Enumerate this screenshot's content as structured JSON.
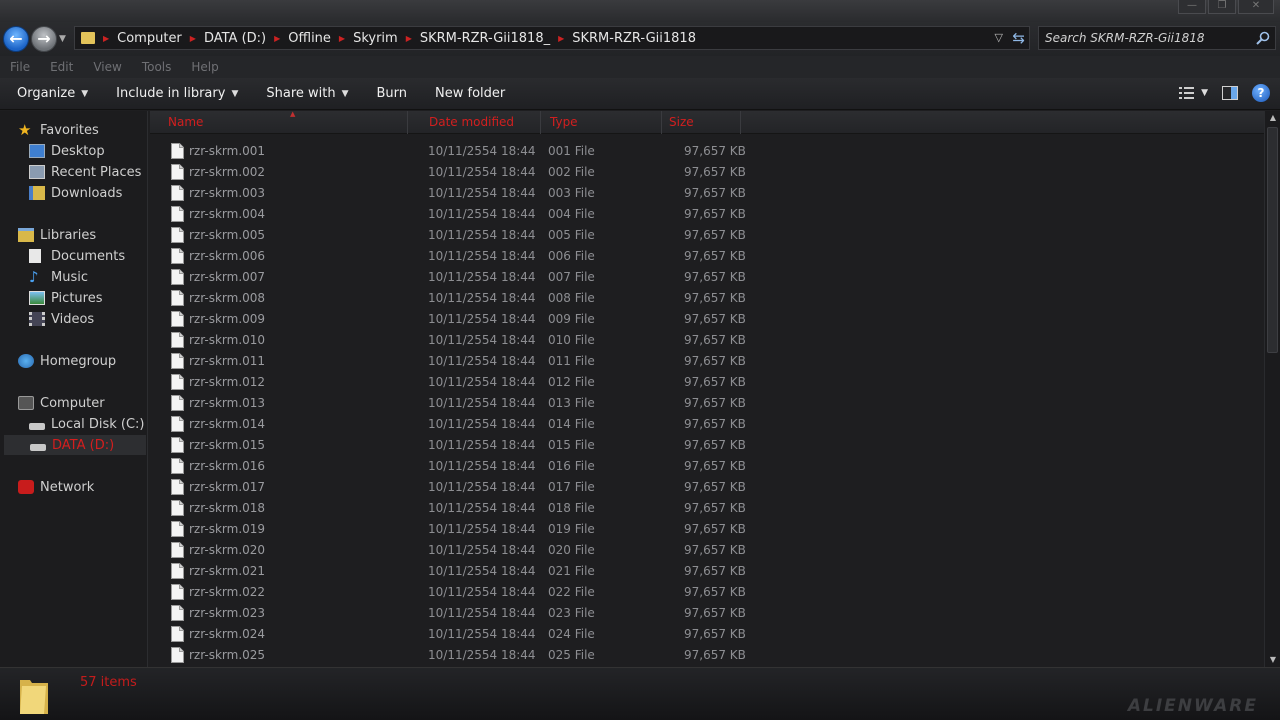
{
  "titlebar": {
    "minimize": "—",
    "maximize": "❐",
    "close": "✕"
  },
  "address": {
    "crumbs": [
      "Computer",
      "DATA (D:)",
      "Offline",
      "Skyrim",
      "SKRM-RZR-Gii1818_",
      "SKRM-RZR-Gii1818"
    ]
  },
  "search": {
    "placeholder": "Search SKRM-RZR-Gii1818"
  },
  "menu": {
    "file": "File",
    "edit": "Edit",
    "view": "View",
    "tools": "Tools",
    "help": "Help"
  },
  "toolbar": {
    "organize": "Organize",
    "include_in_library": "Include in library",
    "share_with": "Share with",
    "burn": "Burn",
    "new_folder": "New folder",
    "help_glyph": "?"
  },
  "nav": {
    "favorites": "Favorites",
    "desktop": "Desktop",
    "recent_places": "Recent Places",
    "downloads": "Downloads",
    "libraries": "Libraries",
    "documents": "Documents",
    "music": "Music",
    "pictures": "Pictures",
    "videos": "Videos",
    "homegroup": "Homegroup",
    "computer": "Computer",
    "local_disk": "Local Disk (C:)",
    "data_drive": "DATA (D:)",
    "network": "Network"
  },
  "columns": {
    "name": "Name",
    "date": "Date modified",
    "type": "Type",
    "size": "Size"
  },
  "files": [
    {
      "name": "rzr-skrm.001",
      "date": "10/11/2554 18:44",
      "type": "001 File",
      "size": "97,657 KB"
    },
    {
      "name": "rzr-skrm.002",
      "date": "10/11/2554 18:44",
      "type": "002 File",
      "size": "97,657 KB"
    },
    {
      "name": "rzr-skrm.003",
      "date": "10/11/2554 18:44",
      "type": "003 File",
      "size": "97,657 KB"
    },
    {
      "name": "rzr-skrm.004",
      "date": "10/11/2554 18:44",
      "type": "004 File",
      "size": "97,657 KB"
    },
    {
      "name": "rzr-skrm.005",
      "date": "10/11/2554 18:44",
      "type": "005 File",
      "size": "97,657 KB"
    },
    {
      "name": "rzr-skrm.006",
      "date": "10/11/2554 18:44",
      "type": "006 File",
      "size": "97,657 KB"
    },
    {
      "name": "rzr-skrm.007",
      "date": "10/11/2554 18:44",
      "type": "007 File",
      "size": "97,657 KB"
    },
    {
      "name": "rzr-skrm.008",
      "date": "10/11/2554 18:44",
      "type": "008 File",
      "size": "97,657 KB"
    },
    {
      "name": "rzr-skrm.009",
      "date": "10/11/2554 18:44",
      "type": "009 File",
      "size": "97,657 KB"
    },
    {
      "name": "rzr-skrm.010",
      "date": "10/11/2554 18:44",
      "type": "010 File",
      "size": "97,657 KB"
    },
    {
      "name": "rzr-skrm.011",
      "date": "10/11/2554 18:44",
      "type": "011 File",
      "size": "97,657 KB"
    },
    {
      "name": "rzr-skrm.012",
      "date": "10/11/2554 18:44",
      "type": "012 File",
      "size": "97,657 KB"
    },
    {
      "name": "rzr-skrm.013",
      "date": "10/11/2554 18:44",
      "type": "013 File",
      "size": "97,657 KB"
    },
    {
      "name": "rzr-skrm.014",
      "date": "10/11/2554 18:44",
      "type": "014 File",
      "size": "97,657 KB"
    },
    {
      "name": "rzr-skrm.015",
      "date": "10/11/2554 18:44",
      "type": "015 File",
      "size": "97,657 KB"
    },
    {
      "name": "rzr-skrm.016",
      "date": "10/11/2554 18:44",
      "type": "016 File",
      "size": "97,657 KB"
    },
    {
      "name": "rzr-skrm.017",
      "date": "10/11/2554 18:44",
      "type": "017 File",
      "size": "97,657 KB"
    },
    {
      "name": "rzr-skrm.018",
      "date": "10/11/2554 18:44",
      "type": "018 File",
      "size": "97,657 KB"
    },
    {
      "name": "rzr-skrm.019",
      "date": "10/11/2554 18:44",
      "type": "019 File",
      "size": "97,657 KB"
    },
    {
      "name": "rzr-skrm.020",
      "date": "10/11/2554 18:44",
      "type": "020 File",
      "size": "97,657 KB"
    },
    {
      "name": "rzr-skrm.021",
      "date": "10/11/2554 18:44",
      "type": "021 File",
      "size": "97,657 KB"
    },
    {
      "name": "rzr-skrm.022",
      "date": "10/11/2554 18:44",
      "type": "022 File",
      "size": "97,657 KB"
    },
    {
      "name": "rzr-skrm.023",
      "date": "10/11/2554 18:44",
      "type": "023 File",
      "size": "97,657 KB"
    },
    {
      "name": "rzr-skrm.024",
      "date": "10/11/2554 18:44",
      "type": "024 File",
      "size": "97,657 KB"
    },
    {
      "name": "rzr-skrm.025",
      "date": "10/11/2554 18:44",
      "type": "025 File",
      "size": "97,657 KB"
    }
  ],
  "status": {
    "item_count": "57 items"
  },
  "brand": {
    "text": "ALIENWARE"
  },
  "colors": {
    "accent_red": "#d21f1f",
    "selection": "#2d2e31",
    "background": "#1e1e20"
  }
}
